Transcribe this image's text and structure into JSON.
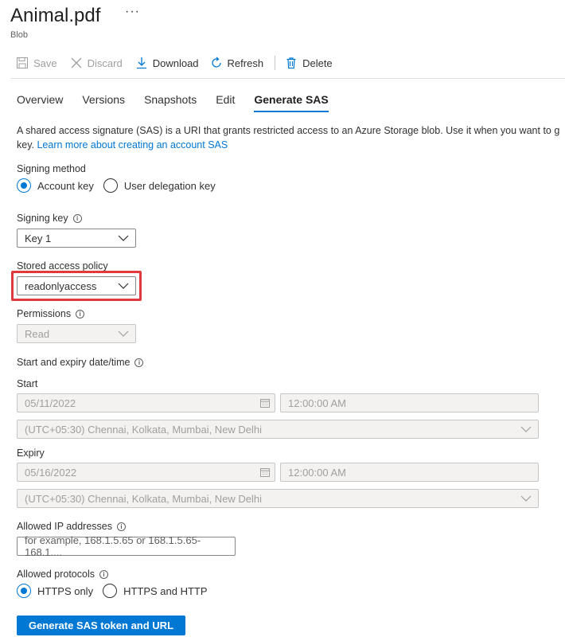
{
  "header": {
    "title": "Animal.pdf",
    "more_label": "···",
    "subtitle": "Blob"
  },
  "toolbar": {
    "save_label": "Save",
    "discard_label": "Discard",
    "download_label": "Download",
    "refresh_label": "Refresh",
    "delete_label": "Delete"
  },
  "tabs": [
    {
      "label": "Overview"
    },
    {
      "label": "Versions"
    },
    {
      "label": "Snapshots"
    },
    {
      "label": "Edit"
    },
    {
      "label": "Generate SAS"
    }
  ],
  "description": {
    "text": "A shared access signature (SAS) is a URI that grants restricted access to an Azure Storage blob. Use it when you want to g",
    "text2": "key. ",
    "link": "Learn more about creating an account SAS"
  },
  "signing_method": {
    "label": "Signing method",
    "options": [
      {
        "label": "Account key",
        "checked": true
      },
      {
        "label": "User delegation key",
        "checked": false
      }
    ]
  },
  "signing_key": {
    "label": "Signing key",
    "value": "Key 1"
  },
  "stored_access_policy": {
    "label": "Stored access policy",
    "value": "readonlyaccess"
  },
  "permissions": {
    "label": "Permissions",
    "value": "Read"
  },
  "dates": {
    "label": "Start and expiry date/time",
    "start_label": "Start",
    "start_date": "05/11/2022",
    "start_time": "12:00:00 AM",
    "start_tz": "(UTC+05:30) Chennai, Kolkata, Mumbai, New Delhi",
    "expiry_label": "Expiry",
    "expiry_date": "05/16/2022",
    "expiry_time": "12:00:00 AM",
    "expiry_tz": "(UTC+05:30) Chennai, Kolkata, Mumbai, New Delhi"
  },
  "allowed_ip": {
    "label": "Allowed IP addresses",
    "placeholder": "for example, 168.1.5.65 or 168.1.5.65-168.1...."
  },
  "allowed_protocols": {
    "label": "Allowed protocols",
    "options": [
      {
        "label": "HTTPS only",
        "checked": true
      },
      {
        "label": "HTTPS and HTTP",
        "checked": false
      }
    ]
  },
  "generate_button": "Generate SAS token and URL",
  "colors": {
    "accent": "#0078d4",
    "highlight": "#e0393e"
  }
}
